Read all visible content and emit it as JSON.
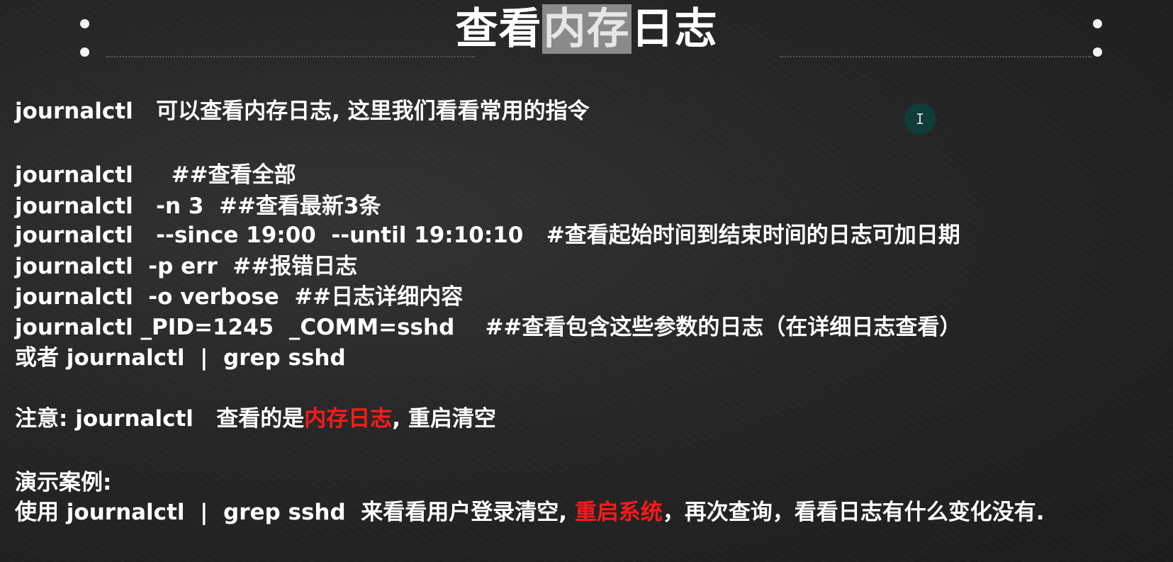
{
  "title": {
    "pre": "查看",
    "highlight": "内存",
    "post": "日志"
  },
  "lines": [
    "journalctl   可以查看内存日志, 这里我们看看常用的指令",
    "journalctl     ##查看全部",
    "journalctl   -n 3  ##查看最新3条",
    "journalctl   --since 19:00  --until 19:10:10   #查看起始时间到结束时间的日志可加日期",
    "journalctl  -p err  ##报错日志",
    "journalctl  -o verbose  ##日志详细内容",
    "journalctl _PID=1245  _COMM=sshd    ##查看包含这些参数的日志（在详细日志查看）",
    "或者 journalctl  |  grep sshd"
  ],
  "note": {
    "pre": "注意: journalctl   查看的是",
    "red": "内存日志",
    "post": ", 重启清空"
  },
  "demo": {
    "heading": "演示案例:",
    "pre": "使用 journalctl  |  grep sshd  来看看用户登录清空, ",
    "red": "重启系统",
    "post": "，再次查询，看看日志有什么变化没有."
  },
  "cursor_icon": "text-cursor-icon",
  "colors": {
    "accent_red": "#ff1a1a",
    "title_highlight_bg": "#8a8a8a",
    "cursor_bg": "#0f3d3a"
  }
}
